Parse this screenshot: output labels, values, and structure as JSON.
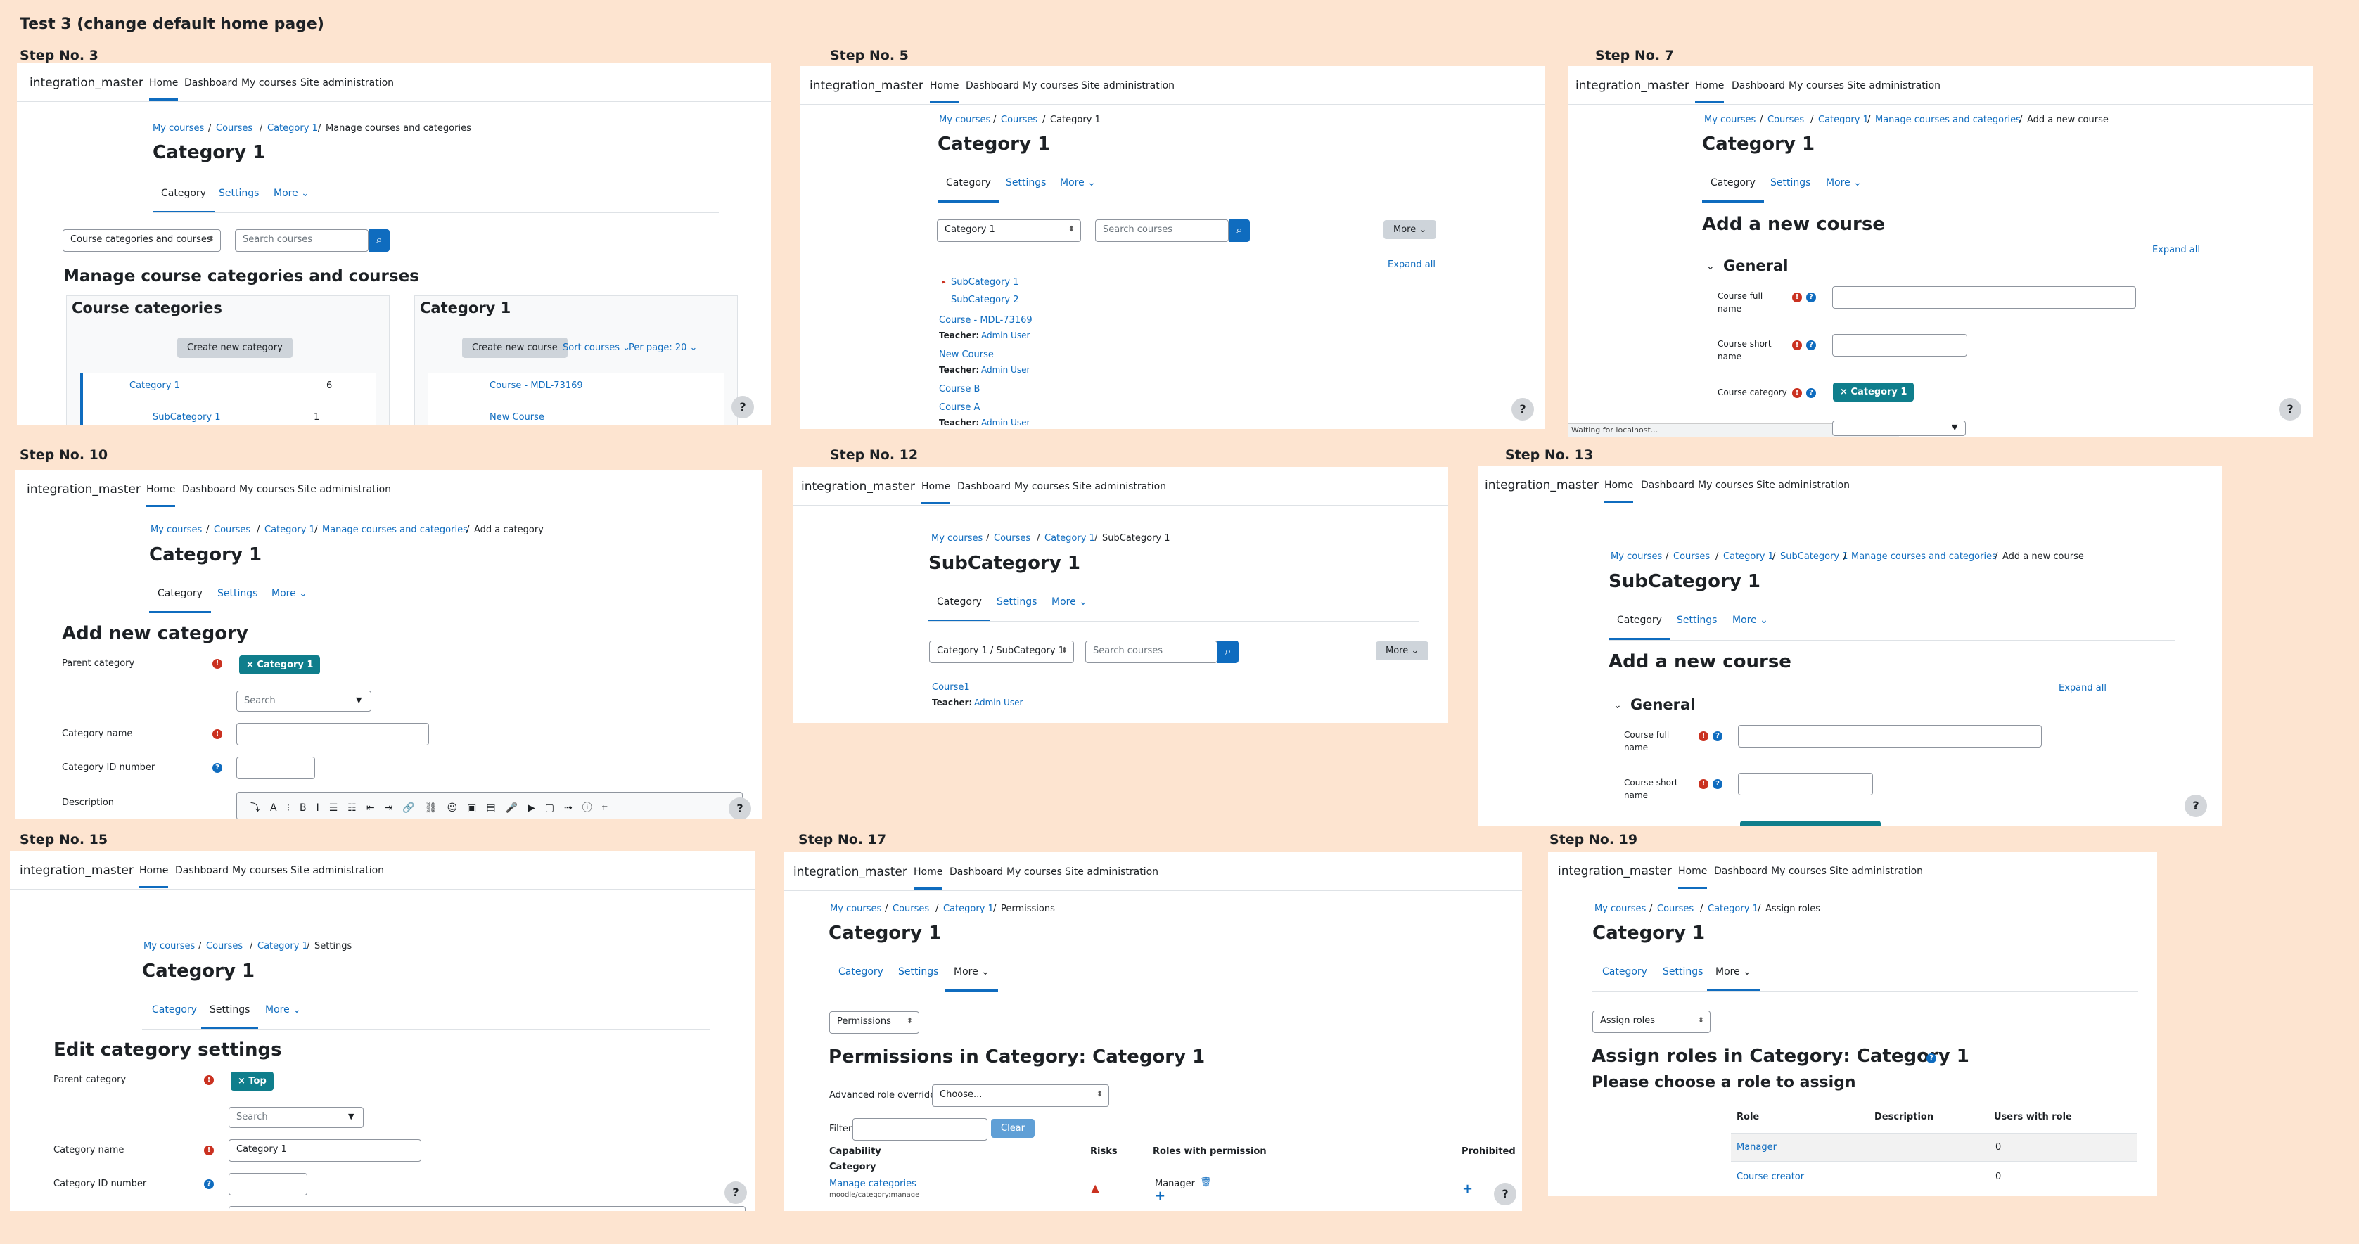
{
  "title": "Test 3 (change default home page)",
  "brand": "integration_master",
  "nav": [
    "Home",
    "Dashboard",
    "My courses",
    "Site administration"
  ],
  "common": {
    "my_courses": "My courses",
    "courses": "Courses",
    "sep": "/",
    "category1": "Category 1",
    "subcategory1": "SubCategory 1",
    "tab_category": "Category",
    "tab_settings": "Settings",
    "tab_more": "More ⌄",
    "search_courses": "Search courses",
    "more_btn": "More ⌄",
    "expand_all": "Expand all",
    "help": "?",
    "teacher": "Teacher:",
    "admin_user": "Admin User",
    "course_full_name": "Course full",
    "name": "name",
    "course_short_name": "Course short",
    "course_category": "Course category",
    "add_new_course": "Add a new course",
    "general": "General",
    "manage_cats": "Manage courses and categories",
    "search": "Search",
    "chip_cat1": "× Category 1"
  },
  "step3": {
    "label": "Step No. 3",
    "bc_last": "Manage courses and categories",
    "select": "Course categories and courses",
    "heading": "Manage course categories and courses",
    "left_title": "Course categories",
    "create_cat": "Create new category",
    "right_title": "Category 1",
    "create_course": "Create new course",
    "sort": "Sort courses ⌄",
    "perpage": "Per page: 20 ⌄",
    "cat_row": "Category 1",
    "cat_count": "6",
    "subcat_row": "SubCategory 1",
    "subcat_count": "1",
    "course_row1": "Course - MDL-73169",
    "course_row2": "New Course"
  },
  "step5": {
    "label": "Step No. 5",
    "select": "Category 1",
    "sub1": "SubCategory 1",
    "sub2": "SubCategory 2",
    "c1": "Course - MDL-73169",
    "c2": "New Course",
    "c3": "Course B",
    "c4": "Course A"
  },
  "step7": {
    "label": "Step No. 7",
    "bc_last": "Add a new course",
    "status": "Waiting for localhost..."
  },
  "step10": {
    "label": "Step No. 10",
    "bc_last": "Add a category",
    "heading": "Add new category",
    "parent": "Parent category",
    "cat_name": "Category name",
    "cat_id": "Category ID number",
    "desc": "Description"
  },
  "step12": {
    "label": "Step No. 12",
    "bc_last": "SubCategory 1",
    "select": "Category 1 / SubCategory 1",
    "course": "Course1"
  },
  "step13": {
    "label": "Step No. 13",
    "bc_last": "Add a new course"
  },
  "step15": {
    "label": "Step No. 15",
    "bc_last": "Settings",
    "heading": "Edit category settings",
    "parent": "Parent category",
    "chip": "× Top",
    "cat_name": "Category name",
    "cat_name_val": "Category 1",
    "cat_id": "Category ID number"
  },
  "step17": {
    "label": "Step No. 17",
    "bc_last": "Permissions",
    "select": "Permissions",
    "heading": "Permissions in Category: Category 1",
    "aro": "Advanced role override",
    "choose": "Choose...",
    "filter": "Filter",
    "clear": "Clear",
    "capability": "Capability",
    "risks": "Risks",
    "roles": "Roles with permission",
    "prohibited": "Prohibited",
    "cat_section": "Category",
    "manage": "Manage categories",
    "manage_sub": "moodle/category:manage",
    "manager": "Manager"
  },
  "step19": {
    "label": "Step No. 19",
    "bc_last": "Assign roles",
    "select": "Assign roles",
    "heading": "Assign roles in Category: Category 1",
    "sub": "Please choose a role to assign",
    "th_role": "Role",
    "th_desc": "Description",
    "th_users": "Users with role",
    "r1": "Manager",
    "r1n": "0",
    "r2": "Course creator",
    "r2n": "0"
  },
  "colors": {
    "accent": "#0f6cbf",
    "chip": "#0f7e8c",
    "required": "#ca3120",
    "background": "#fde4d0"
  }
}
